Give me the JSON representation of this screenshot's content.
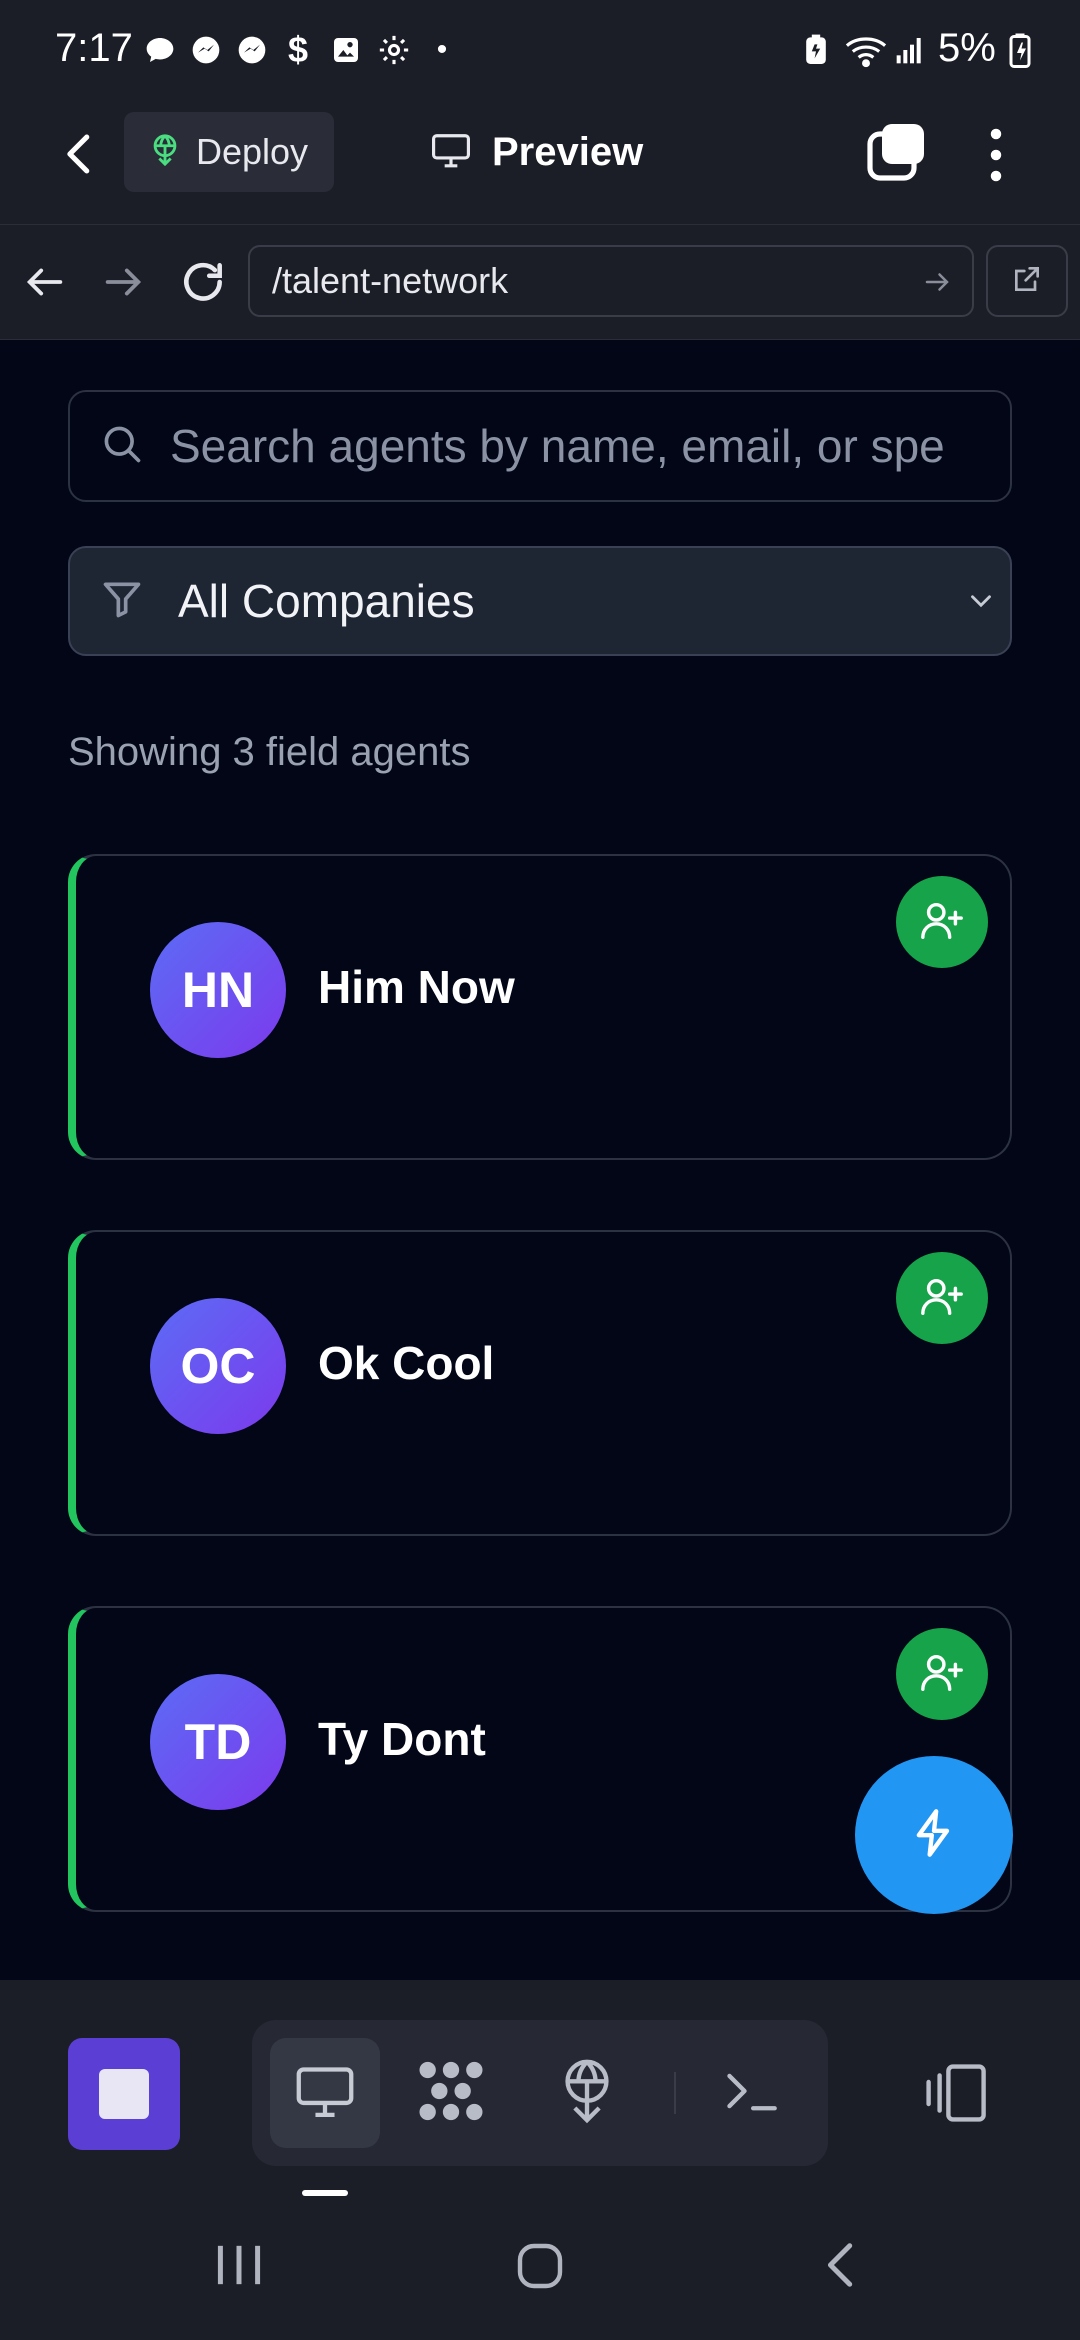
{
  "status_bar": {
    "time": "7:17",
    "battery_percent": "5%"
  },
  "app_header": {
    "deploy_label": "Deploy",
    "preview_label": "Preview"
  },
  "browser": {
    "url": "/talent-network"
  },
  "search": {
    "placeholder": "Search agents by name, email, or spe"
  },
  "filter": {
    "selected": "All Companies"
  },
  "results_summary": "Showing 3 field agents",
  "agents": [
    {
      "initials": "HN",
      "name": "Him Now"
    },
    {
      "initials": "OC",
      "name": "Ok Cool"
    },
    {
      "initials": "TD",
      "name": "Ty Dont"
    }
  ],
  "colors": {
    "accent_green": "#22c55e",
    "fab_blue": "#2196f3",
    "stop_purple": "#5b3fd4",
    "avatar_gradient_start": "#5b6cf5",
    "avatar_gradient_end": "#7c3aed"
  },
  "icons": {
    "fab": "lightning-icon",
    "add_agent": "user-plus-icon"
  }
}
